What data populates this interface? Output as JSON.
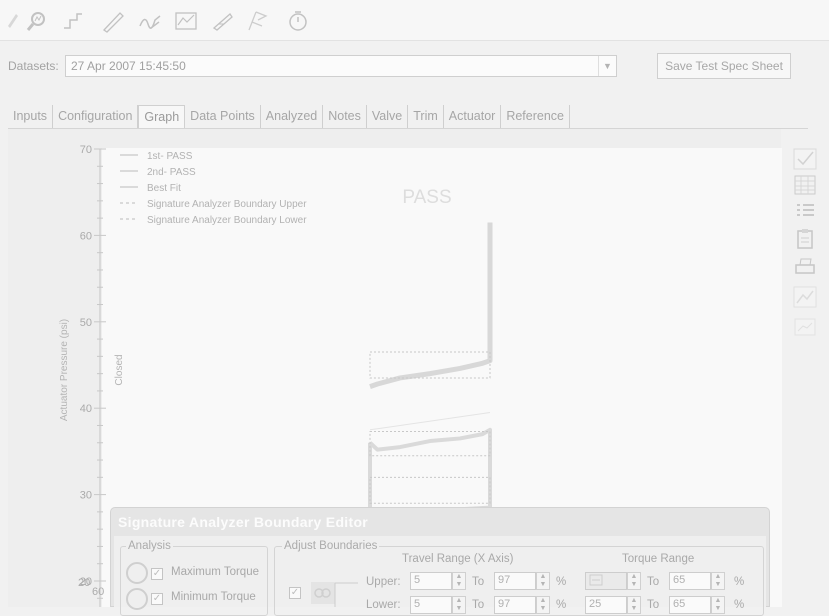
{
  "toolbar": {
    "icons": [
      "pencil-icon",
      "search-plot-icon",
      "step-icon",
      "line-draw-icon",
      "signature-icon",
      "chart-icon",
      "pen-icon",
      "flags-icon",
      "timer-icon"
    ]
  },
  "datasets": {
    "label": "Datasets:",
    "value": "27 Apr 2007 15:45:50",
    "save_label": "Save Test Spec Sheet"
  },
  "tabs": [
    {
      "label": "Inputs"
    },
    {
      "label": "Configuration"
    },
    {
      "label": "Graph",
      "active": true
    },
    {
      "label": "Data Points"
    },
    {
      "label": "Analyzed"
    },
    {
      "label": "Notes"
    },
    {
      "label": "Valve"
    },
    {
      "label": "Trim"
    },
    {
      "label": "Actuator"
    },
    {
      "label": "Reference"
    }
  ],
  "chart_data": {
    "type": "line",
    "title": "PASS",
    "ylabel": "Actuator Pressure (psi)",
    "secondary_label": "Closed",
    "ylim": [
      17,
      72
    ],
    "y_ticks": [
      20,
      30,
      40,
      50,
      60,
      70
    ],
    "legend": [
      {
        "name": "1st- PASS",
        "style": "solid"
      },
      {
        "name": "2nd- PASS",
        "style": "solid"
      },
      {
        "name": "Best Fit",
        "style": "solid"
      },
      {
        "name": "Signature Analyzer Boundary Upper",
        "style": "dashed"
      },
      {
        "name": "Signature Analyzer Boundary Lower",
        "style": "dashed"
      }
    ],
    "series": [
      {
        "name": "1st- PASS",
        "points": [
          [
            0,
            42.5
          ],
          [
            5,
            42.8
          ],
          [
            20,
            43.5
          ],
          [
            40,
            44.0
          ],
          [
            60,
            44.6
          ],
          [
            75,
            45.2
          ],
          [
            80,
            45.5
          ],
          [
            80,
            60
          ],
          [
            80,
            61.5
          ]
        ]
      },
      {
        "name": "2nd- PASS",
        "points": [
          [
            0,
            36.0
          ],
          [
            5,
            35.2
          ],
          [
            20,
            35.5
          ],
          [
            40,
            36.2
          ],
          [
            60,
            36.5
          ],
          [
            75,
            37.0
          ],
          [
            80,
            37.5
          ],
          [
            80,
            28.5
          ],
          [
            60,
            28.3
          ],
          [
            40,
            28.0
          ],
          [
            20,
            27.8
          ],
          [
            0,
            28.0
          ],
          [
            0,
            36.0
          ]
        ]
      },
      {
        "name": "Best Fit",
        "points": [
          [
            0,
            37.5
          ],
          [
            80,
            39.5
          ]
        ]
      }
    ],
    "legend_position": "top-left"
  },
  "side_tools": [
    "checkmark-icon",
    "grid-icon",
    "list-icon",
    "clipboard-icon",
    "printer-icon",
    "chart-line-icon",
    "chart-small-icon"
  ],
  "editor": {
    "title": "Signature Analyzer Boundary Editor",
    "analysis_label": "Analysis",
    "analysis_items": [
      {
        "label": "Maximum Torque",
        "checked": true
      },
      {
        "label": "Minimum Torque",
        "checked": true
      }
    ],
    "adjust_label": "Adjust Boundaries",
    "travel_range_label": "Travel Range (X Axis)",
    "torque_range_label": "Torque Range",
    "upper_label": "Upper:",
    "lower_label": "Lower:",
    "to_label": "To",
    "pct": "%",
    "upper_travel_from": "5",
    "upper_travel_to": "97",
    "upper_torque_to": "65",
    "lower_travel_from": "5",
    "lower_travel_to": "97",
    "lower_torque_from": "25",
    "lower_torque_to": "65",
    "y_tick_20": "20",
    "y_tick_60": "60"
  }
}
